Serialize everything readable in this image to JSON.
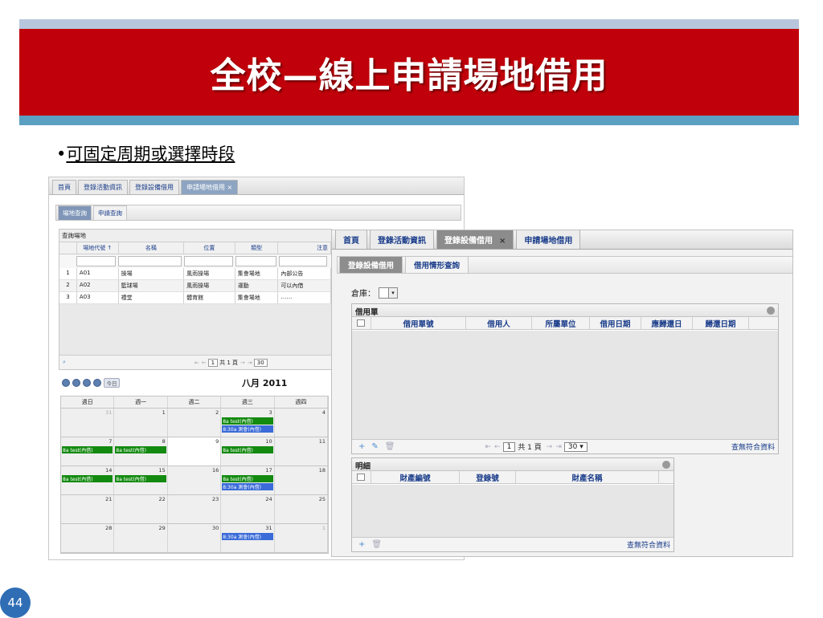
{
  "slide": {
    "title": "全校—線上申請場地借用",
    "bullet_mark": "•",
    "bullet": "可固定周期或選擇時段",
    "page_number": "44"
  },
  "venue_app": {
    "tabs": [
      "首頁",
      "登錄活動資訊",
      "登錄設備借用",
      "申請場地借用"
    ],
    "active_tab": "申請場地借用",
    "close_glyph": "×",
    "subtabs": [
      "場地查詢",
      "申請查詢"
    ],
    "grid": {
      "caption": "查詢場地",
      "columns": [
        "",
        "場地代號 ↑",
        "名稱",
        "位置",
        "類型",
        "注意"
      ],
      "rows": [
        [
          "1",
          "A01",
          "操場",
          "風雨操場",
          "集會場地",
          "內部公告"
        ],
        [
          "2",
          "A02",
          "籃球場",
          "風雨操場",
          "運動",
          "可以內借"
        ],
        [
          "3",
          "A03",
          "禮堂",
          "體育館",
          "集會場地",
          "……"
        ]
      ],
      "pager": {
        "first": "⇤",
        "prev": "←",
        "page": "1",
        "total": "共 1 頁",
        "next": "→",
        "last": "⇥",
        "size": "30",
        "search": "⌕"
      }
    },
    "calendar": {
      "today_label": "今日",
      "month": "八月 2011",
      "weekdays": [
        "週日",
        "週一",
        "週二",
        "週三",
        "週四"
      ],
      "weeks": [
        {
          "days": [
            "31",
            "1",
            "2",
            "3",
            "4"
          ]
        },
        {
          "days": [
            "7",
            "8",
            "9",
            "10",
            "11"
          ]
        },
        {
          "days": [
            "14",
            "15",
            "16",
            "17",
            "18"
          ]
        },
        {
          "days": [
            "21",
            "22",
            "23",
            "24",
            "25"
          ]
        },
        {
          "days": [
            "28",
            "29",
            "30",
            "31",
            "1"
          ]
        }
      ],
      "events": {
        "e1": "8a test(內借)",
        "e2": "8:30a 測會(內借)"
      }
    }
  },
  "equipment_app": {
    "tabs": [
      "首頁",
      "登錄活動資訊",
      "登錄設備借用",
      "申請場地借用"
    ],
    "active_tab": "登錄設備借用",
    "close_glyph": "×",
    "subtabs": [
      "登錄設備借用",
      "借用情形查詢"
    ],
    "warehouse_label": "倉庫：",
    "borrow_panel": {
      "title": "借用單",
      "columns": [
        "借用單號",
        "借用人",
        "所屬單位",
        "借用日期",
        "應歸還日",
        "歸還日期"
      ],
      "pager": {
        "first": "⇤",
        "prev": "←",
        "page": "1",
        "total": "共 1 頁",
        "next": "→",
        "last": "⇥",
        "size": "30"
      },
      "empty": "查無符合資料"
    },
    "detail_panel": {
      "title": "明細",
      "columns": [
        "財產編號",
        "登錄號",
        "財產名稱"
      ],
      "empty": "查無符合資料"
    },
    "icons": {
      "add": "+",
      "edit": "✎",
      "delete": "🗑",
      "dropdown": "▾"
    }
  }
}
